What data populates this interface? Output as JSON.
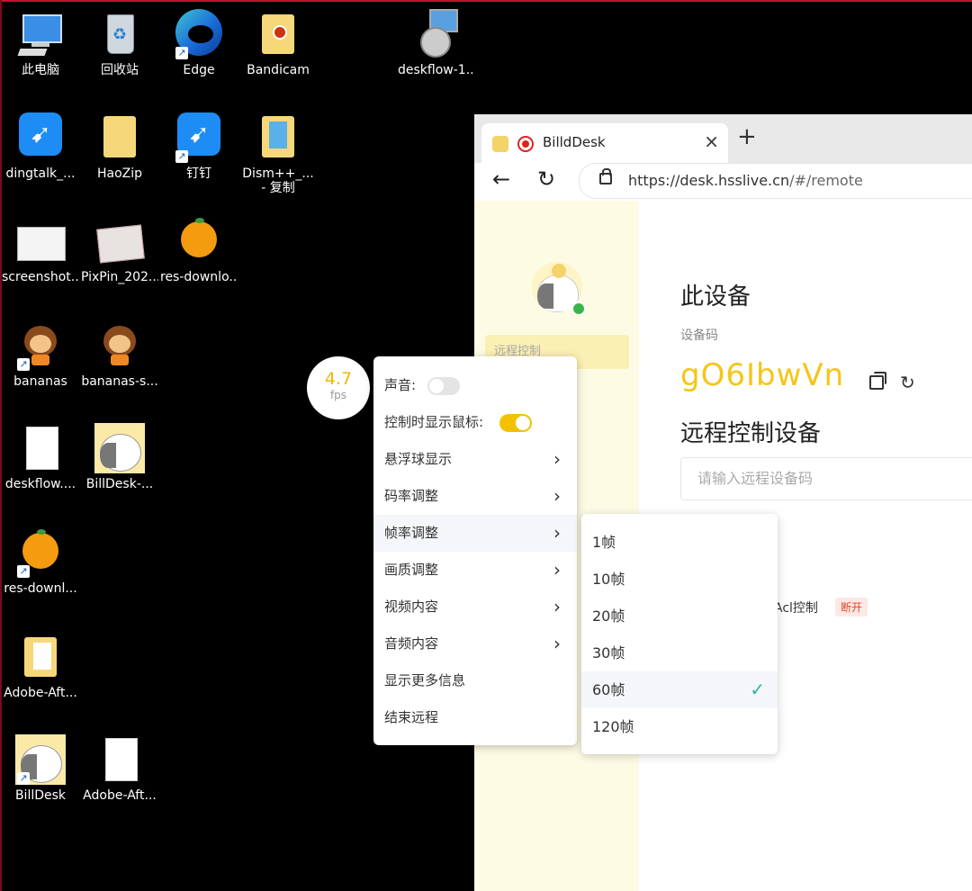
{
  "desktop": {
    "icons": [
      {
        "label": "此电脑",
        "icon": "computer-icon"
      },
      {
        "label": "回收站",
        "icon": "recycle-bin-icon"
      },
      {
        "label": "Edge",
        "icon": "edge-icon"
      },
      {
        "label": "Bandicam",
        "icon": "folder-icon"
      },
      {
        "label": "deskflow-1...",
        "icon": "installer-icon"
      },
      {
        "label": "dingtalk_...",
        "icon": "dingtalk-icon"
      },
      {
        "label": "HaoZip",
        "icon": "folder-icon"
      },
      {
        "label": "钉钉",
        "icon": "dingtalk-icon"
      },
      {
        "label": "Dism++_...",
        "label2": "- 复制",
        "icon": "folder-icon"
      },
      {
        "label": "screenshot...",
        "icon": "image-thumbnail-icon"
      },
      {
        "label": "PixPin_202...",
        "icon": "image-thumbnail-icon"
      },
      {
        "label": "res-downlo...",
        "icon": "orange-icon"
      },
      {
        "label": "bananas",
        "icon": "monkey-icon"
      },
      {
        "label": "bananas-s...",
        "icon": "monkey-icon"
      },
      {
        "label": "deskflow....",
        "icon": "file-icon"
      },
      {
        "label": "BillDesk-...",
        "icon": "billdesk-icon"
      },
      {
        "label": "res-downl...",
        "icon": "orange-icon"
      },
      {
        "label": "Adobe-Aft...",
        "icon": "folder-icon"
      },
      {
        "label": "BillDesk",
        "icon": "billdesk-icon"
      },
      {
        "label": "Adobe-Aft...",
        "icon": "file-icon"
      }
    ]
  },
  "browser": {
    "tab_title": "BilldDesk",
    "tab_close": "×",
    "new_tab": "+",
    "url_host": "https://desk.hsslive.cn",
    "url_path": "/#/remote"
  },
  "app": {
    "sidebar_item": "远程控制",
    "this_device": "此设备",
    "device_code_label": "设备码",
    "device_code": "gO6IbwVn",
    "remote_title": "远程控制设备",
    "remote_placeholder": "请输入远程设备码",
    "acl_text": "Acl控制",
    "disconnect": "断开"
  },
  "fps": {
    "value": "4.7",
    "unit": "fps"
  },
  "menu": {
    "sound": "声音:",
    "sound_on": false,
    "show_cursor": "控制时显示鼠标:",
    "show_cursor_on": true,
    "floating_ball": "悬浮球显示",
    "bitrate": "码率调整",
    "framerate": "帧率调整",
    "quality": "画质调整",
    "video_content": "视频内容",
    "audio_content": "音频内容",
    "more_info": "显示更多信息",
    "end_remote": "结束远程"
  },
  "framerate_submenu": {
    "options": [
      "1帧",
      "10帧",
      "20帧",
      "30帧",
      "60帧",
      "120帧"
    ],
    "selected": "60帧"
  },
  "colors": {
    "accent": "#f2c200",
    "check": "#2eb39a",
    "danger": "#e2472f"
  }
}
